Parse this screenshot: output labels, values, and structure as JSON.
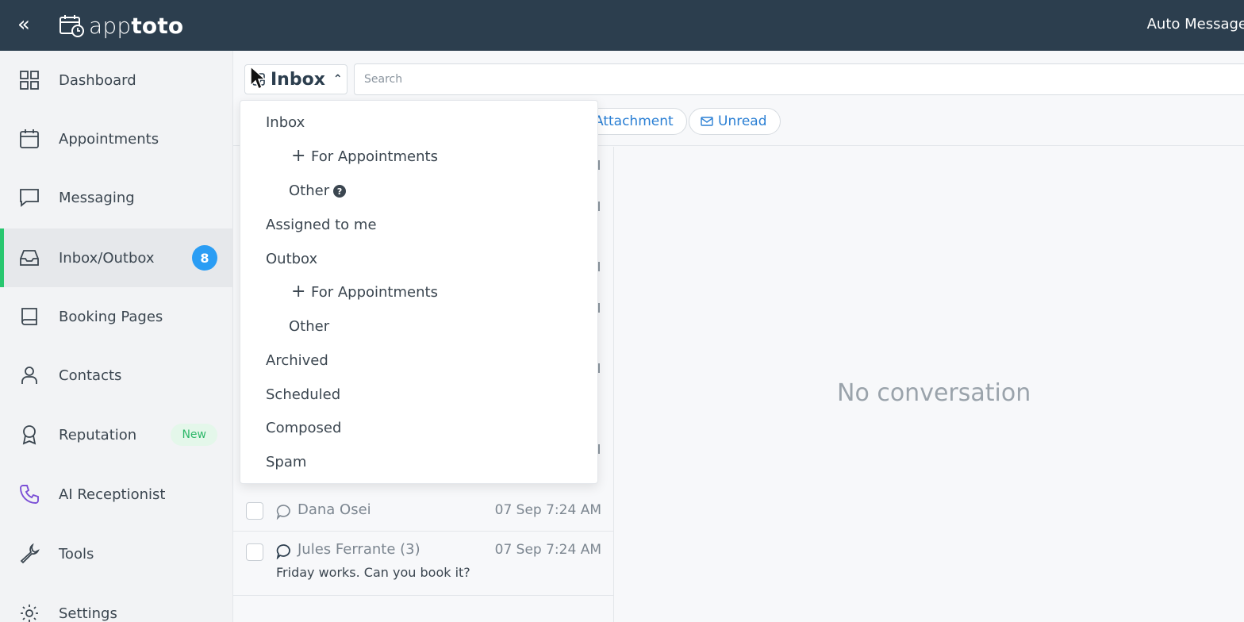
{
  "topbar": {
    "collapse_label": "«",
    "logo_light": "app",
    "logo_bold": "toto",
    "right_text": "Auto Message"
  },
  "sidebar": {
    "items": [
      {
        "label": "Dashboard",
        "icon": "grid-icon"
      },
      {
        "label": "Appointments",
        "icon": "calendar-icon"
      },
      {
        "label": "Messaging",
        "icon": "chat-icon"
      },
      {
        "label": "Inbox/Outbox",
        "icon": "inbox-icon",
        "badge": "8",
        "active": true
      },
      {
        "label": "Booking Pages",
        "icon": "book-icon"
      },
      {
        "label": "Contacts",
        "icon": "person-icon"
      },
      {
        "label": "Reputation",
        "icon": "award-icon",
        "badge": "New"
      },
      {
        "label": "AI Receptionist",
        "icon": "phone-icon"
      },
      {
        "label": "Tools",
        "icon": "wrench-icon"
      },
      {
        "label": "Settings",
        "icon": "gear-icon"
      }
    ]
  },
  "main": {
    "folder_title": "Inbox",
    "search_placeholder": "Search",
    "filters": [
      {
        "label": "Attachment"
      },
      {
        "label": "Unread",
        "icon": "envelope-icon"
      }
    ],
    "conversations": [
      {
        "name": "Dana Osei",
        "date": "07 Sep 7:24 AM",
        "unread": false
      },
      {
        "name": "Jules Ferrante (3)",
        "date": "07 Sep 7:24 AM",
        "preview": "Friday works. Can you book it?",
        "unread": true
      }
    ],
    "empty_text": "No conversation"
  },
  "dropdown": {
    "items": [
      {
        "label": "Inbox"
      },
      {
        "label": "For Appointments"
      },
      {
        "label": "Other"
      },
      {
        "label": "Assigned to me"
      },
      {
        "label": "Outbox"
      },
      {
        "label": "For Appointments"
      },
      {
        "label": "Other"
      },
      {
        "label": "Archived"
      },
      {
        "label": "Scheduled"
      },
      {
        "label": "Composed"
      },
      {
        "label": "Spam"
      }
    ],
    "help_glyph": "?"
  },
  "colors": {
    "topbar": "#2c3e4e",
    "active_indicator": "#28c76f",
    "badge": "#2a9df4",
    "link": "#2a7fd4",
    "ai_icon": "#7b4fd6"
  }
}
